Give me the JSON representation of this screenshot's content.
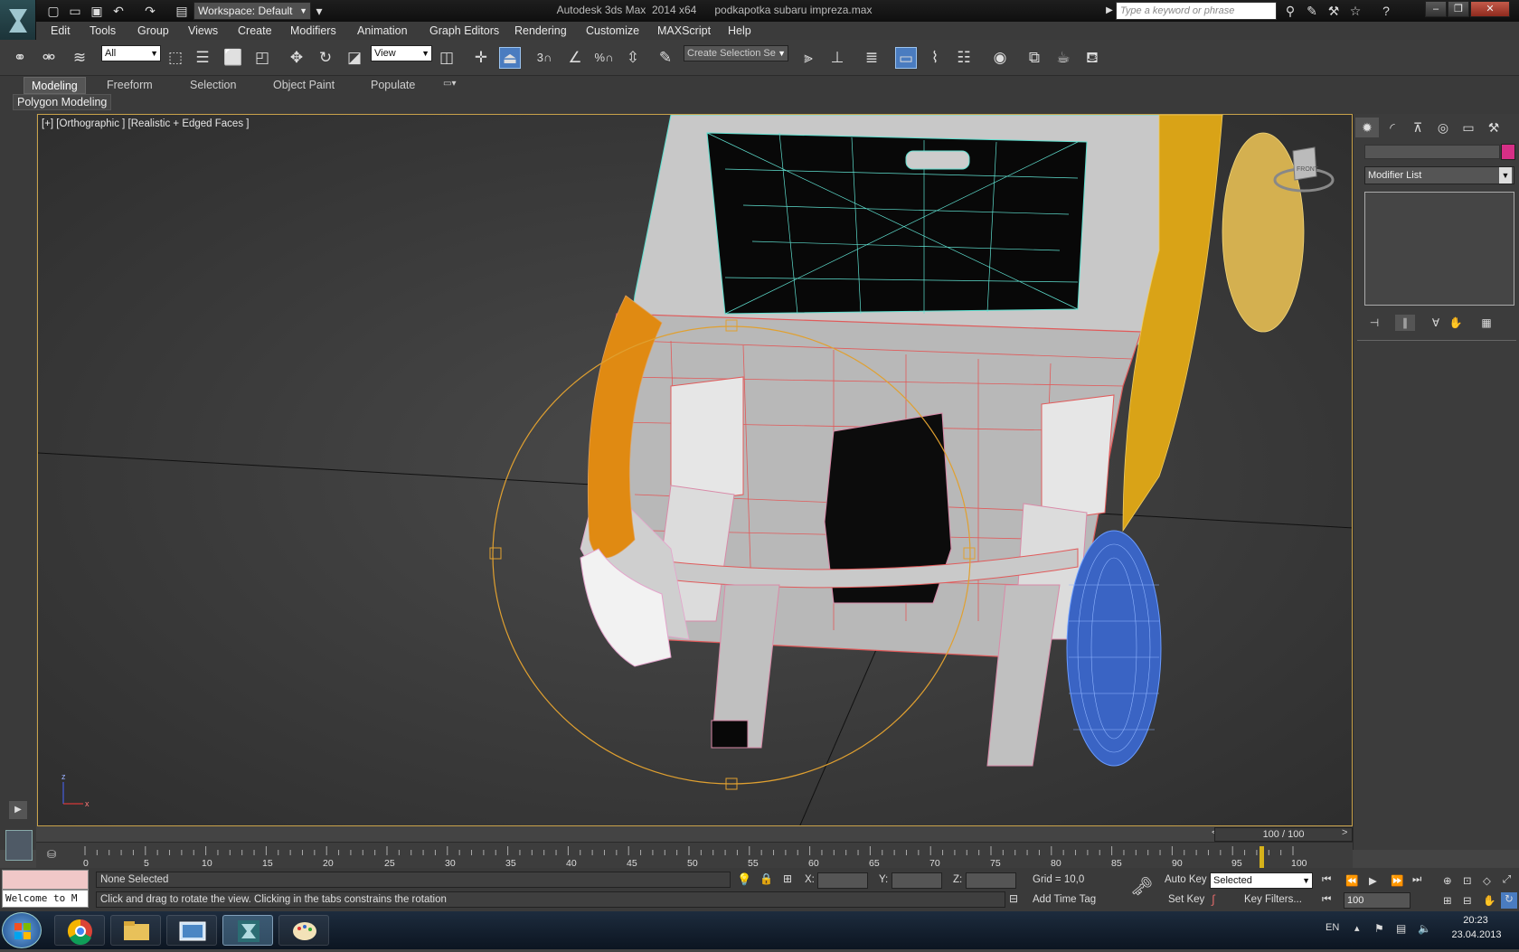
{
  "titlebar": {
    "workspace": "Workspace: Default",
    "app_title": "Autodesk 3ds Max  2014 x64",
    "file_name": "podkapotka subaru impreza.max",
    "search_placeholder": "Type a keyword or phrase"
  },
  "menu": [
    "Edit",
    "Tools",
    "Group",
    "Views",
    "Create",
    "Modifiers",
    "Animation",
    "Graph Editors",
    "Rendering",
    "Customize",
    "MAXScript",
    "Help"
  ],
  "toolbar": {
    "filter_value": "All",
    "coord_value": "View",
    "selection_set_value": "Create Selection Se",
    "snap_3": "3",
    "snap_percent": "%"
  },
  "ribbon": {
    "tabs": [
      "Modeling",
      "Freeform",
      "Selection",
      "Object Paint",
      "Populate"
    ],
    "panel_label": "Polygon Modeling"
  },
  "viewport": {
    "label": "[+] [Orthographic ] [Realistic + Edged Faces ]",
    "viewcube_label": "FRONT",
    "axis_x": "x",
    "axis_z": "z"
  },
  "command_panel": {
    "modifier_list": "Modifier List",
    "object_color": "#d62f86"
  },
  "timeline": {
    "frame_counter": "100 / 100",
    "ticks": [
      "0",
      "5",
      "10",
      "15",
      "20",
      "25",
      "30",
      "35",
      "40",
      "45",
      "50",
      "55",
      "60",
      "65",
      "70",
      "75",
      "80",
      "85",
      "90",
      "95",
      "100"
    ]
  },
  "status": {
    "maxscript_listener": "Welcome to M",
    "selection": "None Selected",
    "prompt": "Click and drag to rotate the view.  Clicking in the tabs constrains the rotation",
    "x_label": "X:",
    "y_label": "Y:",
    "z_label": "Z:",
    "grid": "Grid = 10,0",
    "add_time_tag": "Add Time Tag",
    "auto_key": "Auto Key",
    "set_key": "Set Key",
    "key_mode": "Selected",
    "key_filters": "Key Filters...",
    "current_frame": "100"
  },
  "taskbar": {
    "lang": "EN",
    "time": "20:23",
    "date": "23.04.2013"
  }
}
